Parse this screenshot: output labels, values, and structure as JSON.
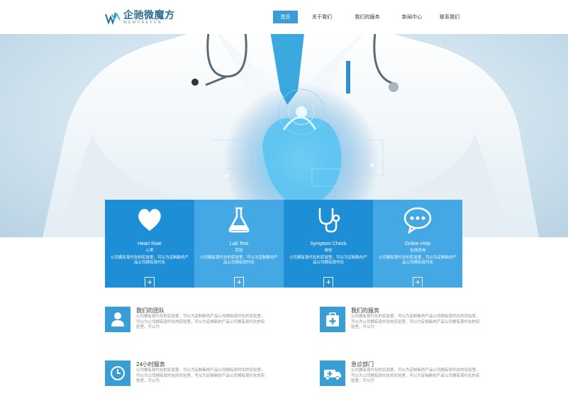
{
  "logo": {
    "cn": "企驰微魔方",
    "en": "WEMOREFUN"
  },
  "nav": [
    "首页",
    "关于我们",
    "我们的服务",
    "新闻中心",
    "联系我们"
  ],
  "features": [
    {
      "title": "Heart Rate",
      "sub": "心率",
      "desc": "公司拥有现代化的实验室，可以为定制新的产品公司拥有现代化",
      "icon": "heart-icon",
      "color": "#1e8fd6"
    },
    {
      "title": "Lab Test",
      "sub": "实验",
      "desc": "公司拥有现代化的实验室，可以为定制新的产品公司拥有现代化",
      "icon": "flask-icon",
      "color": "#43a8e4"
    },
    {
      "title": "Symptom Check",
      "sub": "体检",
      "desc": "公司拥有现代化的实验室，可以为定制新的产品公司拥有现代化",
      "icon": "stethoscope-icon",
      "color": "#1e8fd6"
    },
    {
      "title": "Online Help",
      "sub": "在线咨询",
      "desc": "公司拥有现代化的实验室，可以为定制新的产品公司拥有现代化",
      "icon": "chat-icon",
      "color": "#43a8e4"
    }
  ],
  "info": [
    {
      "title": "我们的团队",
      "desc": "公司拥有现代化的实验室，可以为定制新的产品公司拥有现代化的实验室，可以为公司拥有现代化的实验室，可以为定制新的产品公司拥有现代化的实验室，可以为",
      "icon": "user-icon"
    },
    {
      "title": "我们的服务",
      "desc": "公司拥有现代化的实验室，可以为定制新的产品公司拥有现代化的实验室，可以为公司拥有现代化的实验室，可以为定制新的产品公司拥有现代化的实验室，可以为",
      "icon": "medical-kit-icon"
    },
    {
      "title": "24小时服务",
      "desc": "公司拥有现代化的实验室，可以为定制新的产品公司拥有现代化的实验室，可以为公司拥有现代化的实验室，可以为定制新的产品公司拥有现代化的实验室，可以为",
      "icon": "clock-icon"
    },
    {
      "title": "急诊部门",
      "desc": "公司拥有现代化的实验室，可以为定制新的产品公司拥有现代化的实验室，可以为公司拥有现代化的实验室，可以为定制新的产品公司拥有现代化的实验室，可以为",
      "icon": "ambulance-icon"
    }
  ],
  "colors": {
    "accent": "#3a9ed6",
    "feature_dark": "#1e8fd6",
    "feature_light": "#43a8e4"
  }
}
